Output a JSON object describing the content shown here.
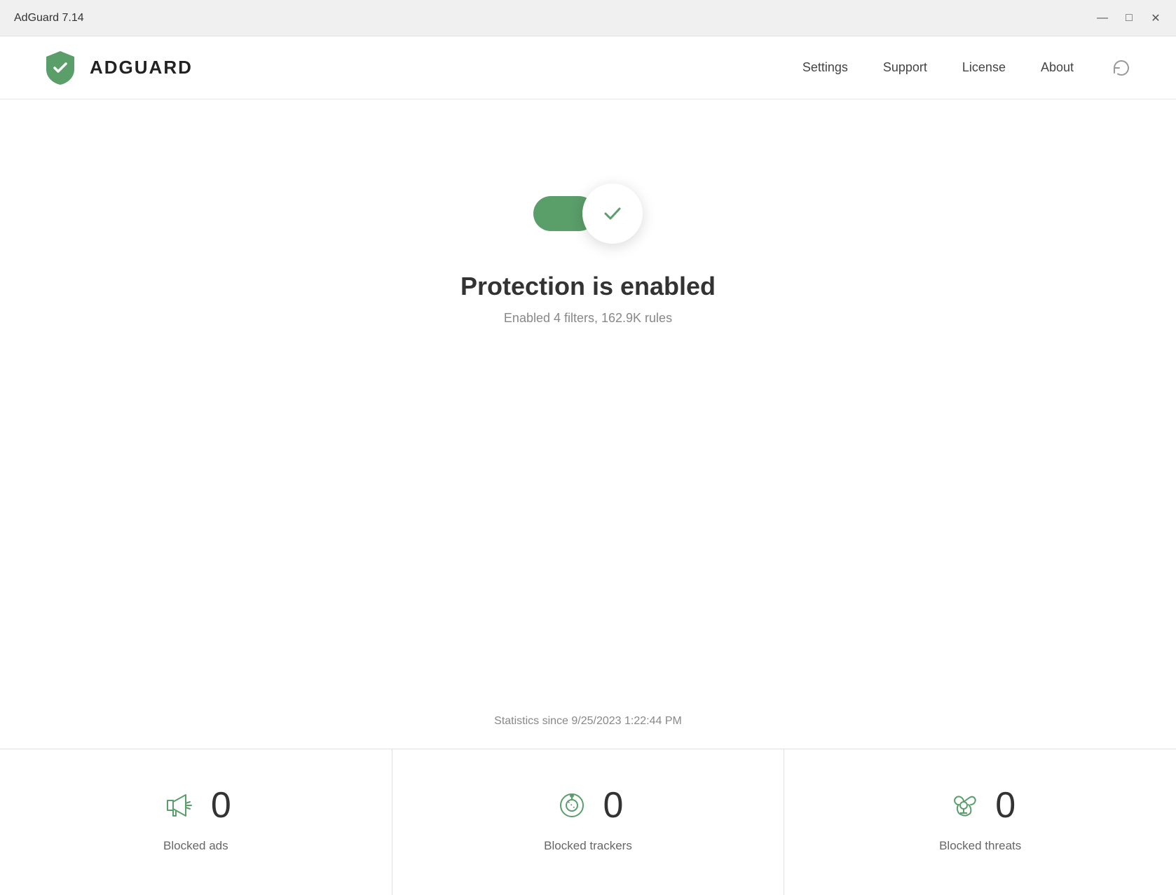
{
  "titlebar": {
    "title": "AdGuard 7.14"
  },
  "window_controls": {
    "minimize": "—",
    "maximize": "□",
    "close": "✕"
  },
  "header": {
    "logo_text": "ADGUARD",
    "nav": {
      "settings": "Settings",
      "support": "Support",
      "license": "License",
      "about": "About"
    }
  },
  "protection": {
    "status_title": "Protection is enabled",
    "status_subtitle": "Enabled 4 filters, 162.9K rules"
  },
  "statistics": {
    "since_label": "Statistics since 9/25/2023 1:22:44 PM",
    "cards": [
      {
        "label": "Blocked ads",
        "value": "0"
      },
      {
        "label": "Blocked trackers",
        "value": "0"
      },
      {
        "label": "Blocked threats",
        "value": "0"
      }
    ]
  },
  "colors": {
    "green": "#5a9e6a",
    "green_light": "#6aad7a"
  }
}
